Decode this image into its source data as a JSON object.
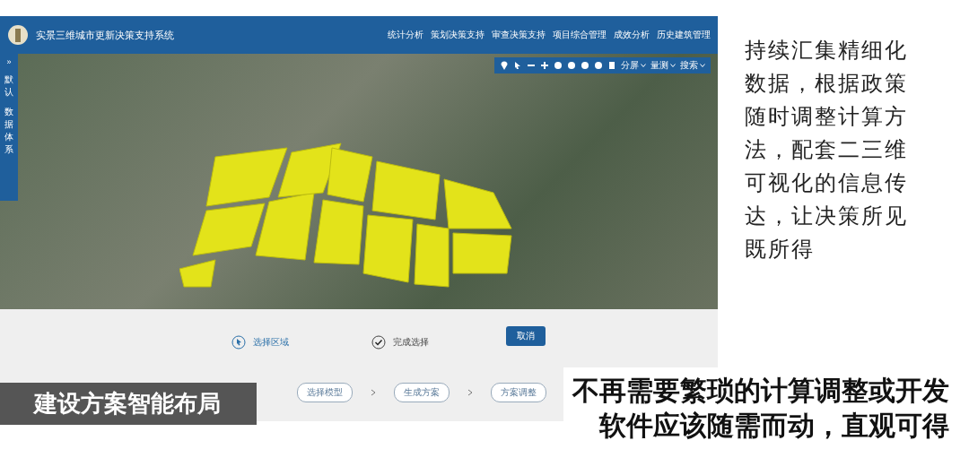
{
  "app": {
    "title": "实景三维城市更新决策支持系统",
    "nav": [
      {
        "label": "统计分析",
        "selected": false
      },
      {
        "label": "策划决策支持",
        "selected": false
      },
      {
        "label": "审查决策支持",
        "selected": false
      },
      {
        "label": "项目综合管理",
        "selected": false
      },
      {
        "label": "成效分析",
        "selected": false
      },
      {
        "label": "历史建筑管理",
        "selected": false
      }
    ],
    "side_toggle": "»",
    "side_items": [
      {
        "label": "默认",
        "selected": false
      },
      {
        "label": "数据体系",
        "selected": false
      }
    ],
    "map_toolbar": {
      "dropdowns": [
        "分屏",
        "量测",
        "搜索"
      ]
    },
    "actions": [
      {
        "kind": "select",
        "label": "选择区域"
      },
      {
        "kind": "done",
        "label": "完成选择"
      }
    ],
    "cancel_button": "取消",
    "steps": [
      "选择模型",
      "生成方案",
      "方案调整"
    ]
  },
  "side_text": "持续汇集精细化数据，根据政策随时调整计算方法，配套二三维可视化的信息传达，让决策所见既所得",
  "caption_left": "建设方案智能布局",
  "caption_right": [
    "不再需要繁琐的计算调整或开发",
    "软件应该随需而动，直观可得"
  ]
}
